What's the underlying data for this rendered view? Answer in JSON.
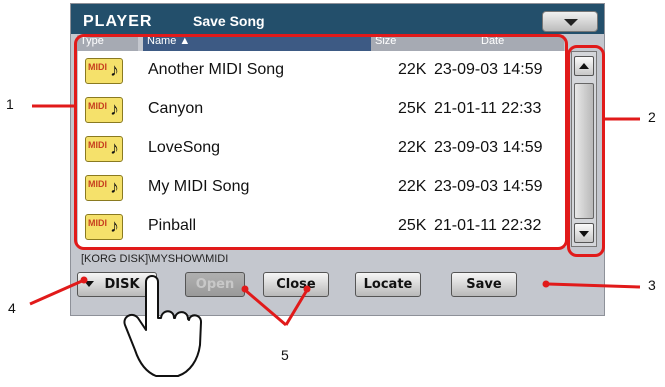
{
  "header": {
    "app": "PLAYER",
    "page": "Save Song"
  },
  "columns": {
    "type": "Type",
    "name": "Name ▲",
    "size": "Size",
    "date": "Date"
  },
  "files": [
    {
      "name": "Another MIDI Song",
      "size": "22K",
      "date": "23-09-03 14:59"
    },
    {
      "name": "Canyon",
      "size": "25K",
      "date": "21-01-11 22:33"
    },
    {
      "name": "LoveSong",
      "size": "22K",
      "date": "23-09-03 14:59"
    },
    {
      "name": "My MIDI Song",
      "size": "22K",
      "date": "23-09-03 14:59"
    },
    {
      "name": "Pinball",
      "size": "25K",
      "date": "21-01-11 22:32"
    }
  ],
  "file_icon_label": "MIDI",
  "path": "[KORG DISK]\\MYSHOW\\MIDI",
  "buttons": {
    "disk": "DISK",
    "open": "Open",
    "close": "Close",
    "locate": "Locate",
    "save": "Save"
  },
  "callouts": [
    "1",
    "2",
    "3",
    "4",
    "5"
  ],
  "colors": {
    "titlebar": "#234f6b",
    "highlight": "#e11a1a",
    "screen_bg": "#c4c7ce"
  }
}
